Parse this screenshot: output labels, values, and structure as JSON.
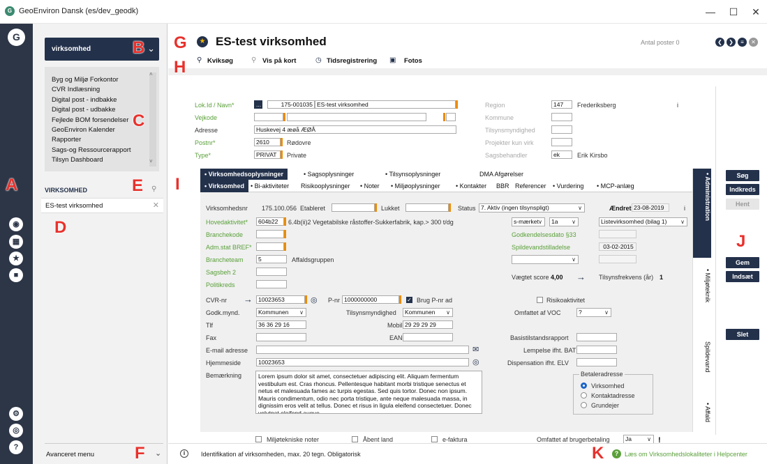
{
  "window": {
    "title": "GeoEnviron Dansk (es/dev_geodk)",
    "app_logo": "G",
    "controls": [
      "—",
      "☐",
      "✕"
    ]
  },
  "rail": {
    "logo": "G",
    "icons": [
      "location-icon",
      "calendar-icon",
      "star-icon",
      "chat-icon",
      "settings-icon",
      "globe-icon",
      "help-icon"
    ]
  },
  "panel": {
    "module": "virksomhed",
    "menu_items": [
      "Byg og Miljø Forkontor",
      "CVR Indlæsning",
      "Digital post - indbakke",
      "Digital post - udbakke",
      "Fejlede BOM forsendelser",
      "GeoEnviron Kalender",
      "Rapporter",
      "Sags-og Ressourcerapport",
      "Tilsyn Dashboard"
    ],
    "section_title": "VIRKSOMHED",
    "list_item": "ES-test virksomhed",
    "advanced_menu": "Avanceret menu"
  },
  "header": {
    "title": "ES-test virksomhed",
    "count": "Antal poster 0",
    "toolbar": {
      "quick_search": "Kviksøg",
      "map": "Vis på kort",
      "time": "Tidsregistrering",
      "photos": "Fotos"
    }
  },
  "topform": {
    "lokid_label": "Lok.Id / Navn*",
    "lokid_btn": "...",
    "lokid_value": "175-001035",
    "name_value": "ES-test virksomhed",
    "vejkode_label": "Vejkode",
    "adresse_label": "Adresse",
    "adresse_value": "Huskevej 4 æøå ÆØÅ",
    "postnr_label": "Postnr*",
    "postnr_value": "2610",
    "postnr_city": "Rødovre",
    "type_label": "Type*",
    "type_value": "PRIVAT",
    "type_text": "Private",
    "region_label": "Region",
    "region_value": "147",
    "region_text": "Frederiksberg",
    "region_info": "i",
    "kommune_label": "Kommune",
    "tilsyn_label": "Tilsynsmyndighed",
    "projekter_label": "Projekter kun virk",
    "sagsb_label": "Sagsbehandler",
    "sagsb_value": "ek",
    "sagsb_text": "Erik Kirsbo"
  },
  "tabs": {
    "row1": [
      "Virksomhedsoplysninger",
      "Sagsoplysninger",
      "Tilsynsoplysninger",
      "DMA Afgørelser"
    ],
    "row2": [
      "Virksomhed",
      "Bi-aktiviteter",
      "Risikooplysninger",
      "Noter",
      "Miljøoplysninger",
      "Kontakter",
      "BBR",
      "Referencer",
      "Vurdering",
      "MCP-anlæg"
    ],
    "vertical": [
      "• Administration",
      "• Miljøteknik",
      "Spildevand",
      "• Affald"
    ]
  },
  "form": {
    "virknr_label": "Virksomhedsnr",
    "virknr_value": "175.100.056",
    "etableret_label": "Etableret",
    "lukket_label": "Lukket",
    "status_label": "Status",
    "status_value": "7. Aktiv (ingen tilsynspligt)",
    "aendret_label": "Ændret",
    "aendret_value": "23-08-2019",
    "aendret_info": "i",
    "hovedakt_label": "Hovedaktivitet*",
    "hovedakt_value": "604b22",
    "hovedakt_text": "6.4b(ii)2  Vegetabilske råstoffer-Sukkerfabrik, kap.> 300 t/dg",
    "maerket_value": "s-mærket",
    "grade_value": "1a",
    "liste_value": "Listevirksomhed (bilag 1)",
    "branchekode_label": "Branchekode",
    "godk_dato_label": "Godkendelsesdato §33",
    "admstat_label": "Adm.stat BREF*",
    "spildevand_label": "Spildevandstilladelse",
    "spildevand_value": "03-02-2015",
    "brancheteam_label": "Brancheteam",
    "brancheteam_value": "5",
    "brancheteam_text": "Affaldsgruppen",
    "sagsb2_label": "Sagsbeh 2",
    "score_label": "Vægtet score",
    "score_value": "4,00",
    "freq_label": "Tilsynsfrekvens (år)",
    "freq_value": "1",
    "politikreds_label": "Politikreds",
    "cvr_label": "CVR-nr",
    "cvr_value": "10023653",
    "pnr_label": "P-nr",
    "pnr_value": "1000000000",
    "brug_pnr_label": "Brug P-nr ad",
    "risiko_label": "Risikoaktivitet",
    "godk_mynd_label": "Godk.mynd.",
    "godk_mynd_value": "Kommunen",
    "tilsynsmynd_label": "Tilsynsmyndighed",
    "tilsynsmynd_value": "Kommunen",
    "voc_label": "Omfattet af VOC",
    "voc_value": "?",
    "tlf_label": "Tlf",
    "tlf_value": "36 36 29 16",
    "mobil_label": "Mobil",
    "mobil_value": "29 29 29 29",
    "fax_label": "Fax",
    "ean_label": "EAN",
    "basis_label": "Basistilstandsrapport",
    "email_label": "E-mail adresse",
    "bat_label": "Lempelse ifht. BAT",
    "web_label": "Hjemmeside",
    "web_value": "10023653",
    "elv_label": "Dispensation ifht. ELV",
    "remark_label": "Bemærkning",
    "remark_value": "Lorem ipsum dolor sit amet, consectetuer adipiscing elit. Aliquam fermentum vestibulum est. Cras rhoncus. Pellentesque habitant morbi tristique senectus et netus et malesuada fames ac turpis egestas. Sed quis tortor. Donec non ipsum. Mauris condimentum, odio nec porta tristique, ante neque malesuada massa, in dignissim eros velit at tellus. Donec et risus in ligula eleifend consectetuer. Donec volutpat eleifend augue.",
    "betaler_title": "Betaleradresse",
    "betaler_options": [
      "Virksomhed",
      "Kontaktadresse",
      "Grundejer"
    ],
    "miljo_noter_label": "Miljøtekniske noter",
    "aabent_land_label": "Åbent land",
    "efaktura_label": "e-faktura",
    "brugerbetaling_label": "Omfattet af brugerbetaling",
    "brugerbetaling_value": "Ja",
    "warn": "!"
  },
  "buttons": {
    "search": "Søg",
    "narrow": "Indkreds",
    "fetch": "Hent",
    "save": "Gem",
    "insert": "Indsæt",
    "delete": "Slet"
  },
  "status": {
    "info_icon": "i",
    "text": "Identifikation af virksomheden, max. 20 tegn. Obligatorisk",
    "help_text": "Læs om Virksomhedslokaliteter  i Helpcenter"
  },
  "callouts": [
    "A",
    "B",
    "C",
    "D",
    "E",
    "F",
    "G",
    "H",
    "I",
    "J",
    "K"
  ],
  "colors": {
    "navy": "#23314b",
    "rail": "#2d3647",
    "accent_green": "#5aa03a",
    "required_orange": "#ed8b00",
    "callout_red": "#e8312c"
  }
}
